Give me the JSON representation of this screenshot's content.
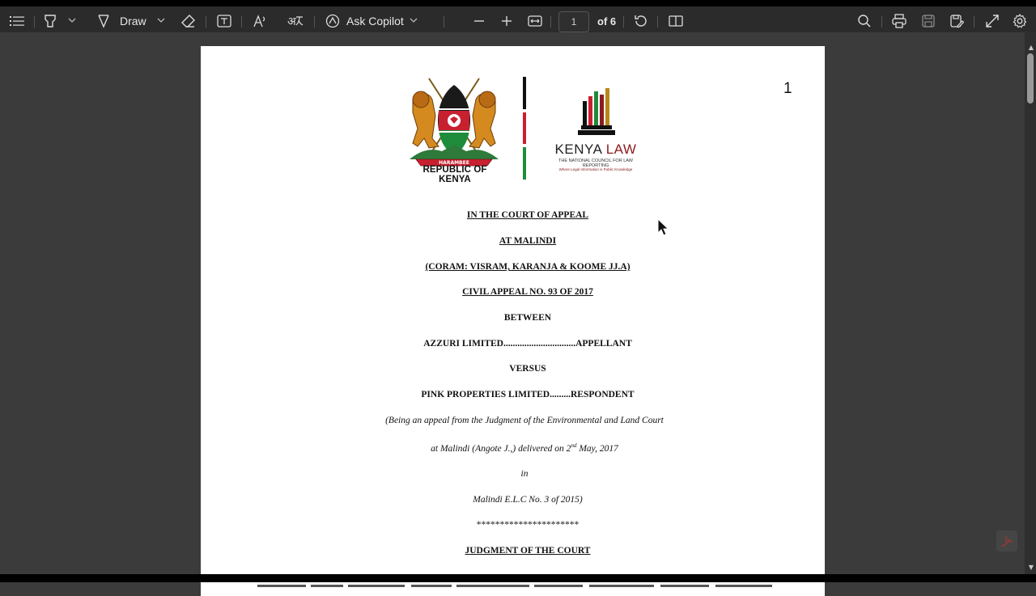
{
  "toolbar": {
    "draw_label": "Draw",
    "ask_copilot_label": "Ask Copilot",
    "page_current": "1",
    "page_total": "of 6"
  },
  "document": {
    "page_number_mark": "1",
    "seal_caption": "REPUBLIC OF KENYA",
    "logo": {
      "kenya": "KENYA",
      "law": "LAW",
      "subtitle": "THE NATIONAL COUNCIL FOR LAW REPORTING",
      "tagline": "Where Legal Information is Public Knowledge"
    },
    "lines": {
      "court": "IN THE COURT OF APPEAL",
      "at": "AT MALINDI",
      "coram": "(CORAM: VISRAM, KARANJA & KOOME JJ.A)",
      "appeal_no": "CIVIL APPEAL NO. 93 OF 2017",
      "between": "BETWEEN",
      "appellant": "AZZURI LIMITED...............................APPELLANT",
      "versus": "VERSUS",
      "respondent": "PINK PROPERTIES LIMITED.........RESPONDENT",
      "being_appeal": "(Being an appeal from the Judgment of the Environmental and Land Court",
      "at_malindi_pre": "at Malindi (Angote J.,) delivered on 2",
      "at_malindi_sup": "nd",
      "at_malindi_post": " May, 2017",
      "in": "in",
      "elc": "Malindi E.L.C No. 3 of 2015)",
      "stars": "**********************",
      "judgment": "JUDGMENT OF THE COURT"
    }
  },
  "colors": {
    "toolbar_bg": "#2b2b2b",
    "viewer_bg": "#3b3b3b",
    "kenya_red": "#c8202f",
    "kenya_green": "#1e8c3a",
    "law_red": "#8b1d22"
  }
}
